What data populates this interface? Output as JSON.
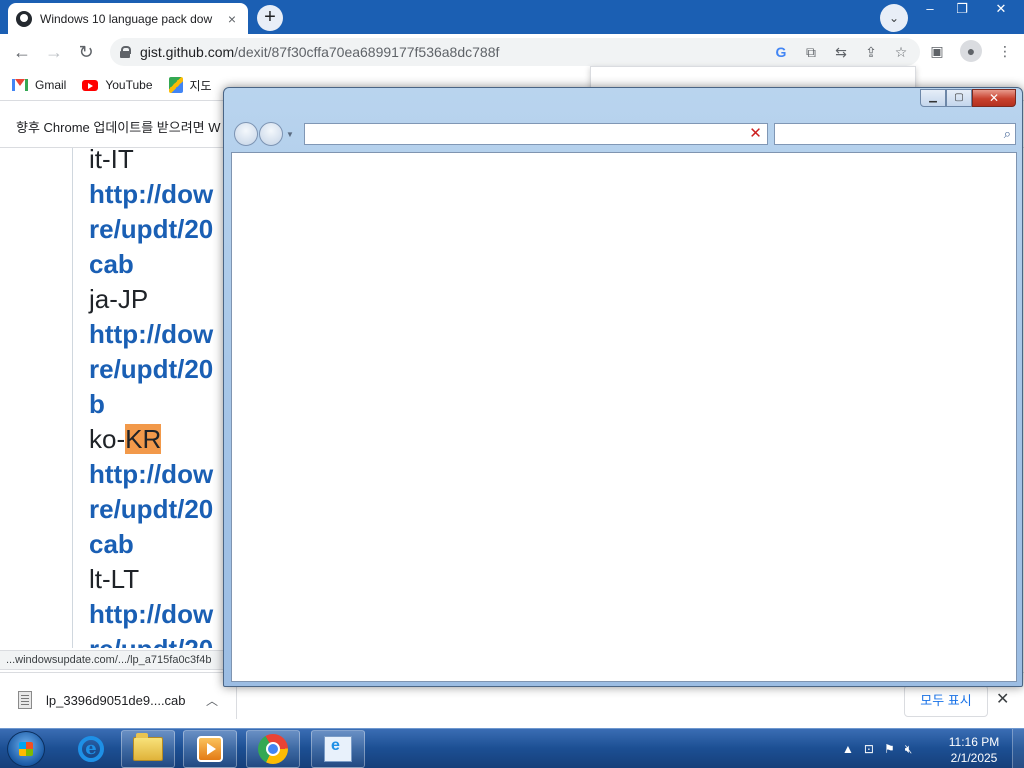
{
  "browser": {
    "tab_title": "Windows 10 language pack dow",
    "tab_close": "×",
    "new_tab": "+",
    "url_domain": "gist.github.com",
    "url_path": "/dexit/87f30cffa70ea6899177f536a8dc788f",
    "bookmarks": [
      {
        "label": "Gmail",
        "icon": "gmail-icon"
      },
      {
        "label": "YouTube",
        "icon": "youtube-icon"
      },
      {
        "label": "지도",
        "icon": "maps-icon"
      }
    ],
    "infobar_text": "향후 Chrome 업데이트를 받으려면 W",
    "status_url": "...windowsupdate.com/.../lp_a715fa0c3f4b"
  },
  "gist_lines": [
    {
      "text": "it-IT",
      "kind": "plain"
    },
    {
      "text": "http://dow",
      "kind": "link"
    },
    {
      "text": "re/updt/20",
      "kind": "link"
    },
    {
      "text": "cab",
      "kind": "link"
    },
    {
      "text": "ja-JP",
      "kind": "plain"
    },
    {
      "text": "http://dow",
      "kind": "link"
    },
    {
      "text": "re/updt/20",
      "kind": "link"
    },
    {
      "text": "b",
      "kind": "link"
    },
    {
      "text": "ko-",
      "highlight": "KR",
      "kind": "plain"
    },
    {
      "text": "http://dow",
      "kind": "link"
    },
    {
      "text": "re/updt/20",
      "kind": "link"
    },
    {
      "text": "cab",
      "kind": "link"
    },
    {
      "text": "lt-LT",
      "kind": "plain"
    },
    {
      "text": "http://dow",
      "kind": "link"
    },
    {
      "text": "re/updt/20",
      "kind": "link"
    }
  ],
  "downloads": {
    "filename": "lp_3396d9051de9....cab",
    "show_all": "모두 표시",
    "close": "✕"
  },
  "popup": {
    "minimize": "▁",
    "maximize": "▢",
    "close": "✕",
    "stop": "✕",
    "search_icon": "⌕"
  },
  "taskbar": {
    "time": "11:16 PM",
    "date": "2/1/2025"
  },
  "colors": {
    "tabstrip": "#1b5fb3",
    "link": "#1a5fb4",
    "highlight": "#f2994a",
    "taskbar": "#1c4f93"
  }
}
